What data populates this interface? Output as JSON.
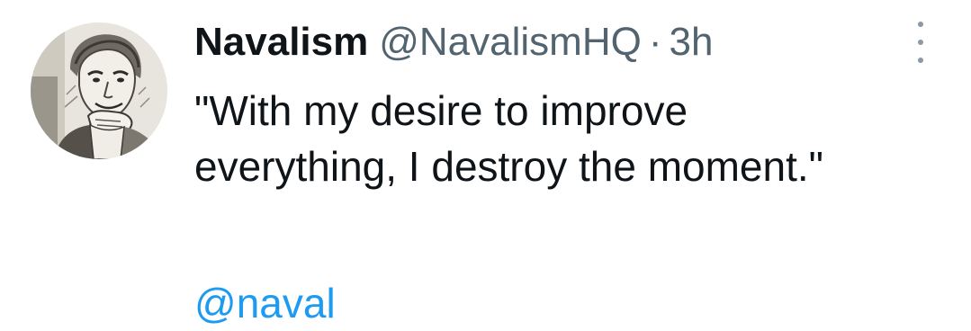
{
  "tweet": {
    "author": {
      "display_name": "Navalism",
      "handle": "@NavalismHQ",
      "avatar_icon": "portrait-sketch-avatar"
    },
    "separator": "·",
    "timestamp": "3h",
    "more_icon": "more-vertical-icon",
    "text_lines": [
      "\"With my desire to improve",
      "everything, I destroy the moment.\""
    ],
    "mention": "@naval"
  },
  "colors": {
    "text_primary": "#0f1419",
    "text_secondary": "#536471",
    "link": "#1d9bf0",
    "more_dots": "#8b98a5",
    "background": "#ffffff"
  }
}
